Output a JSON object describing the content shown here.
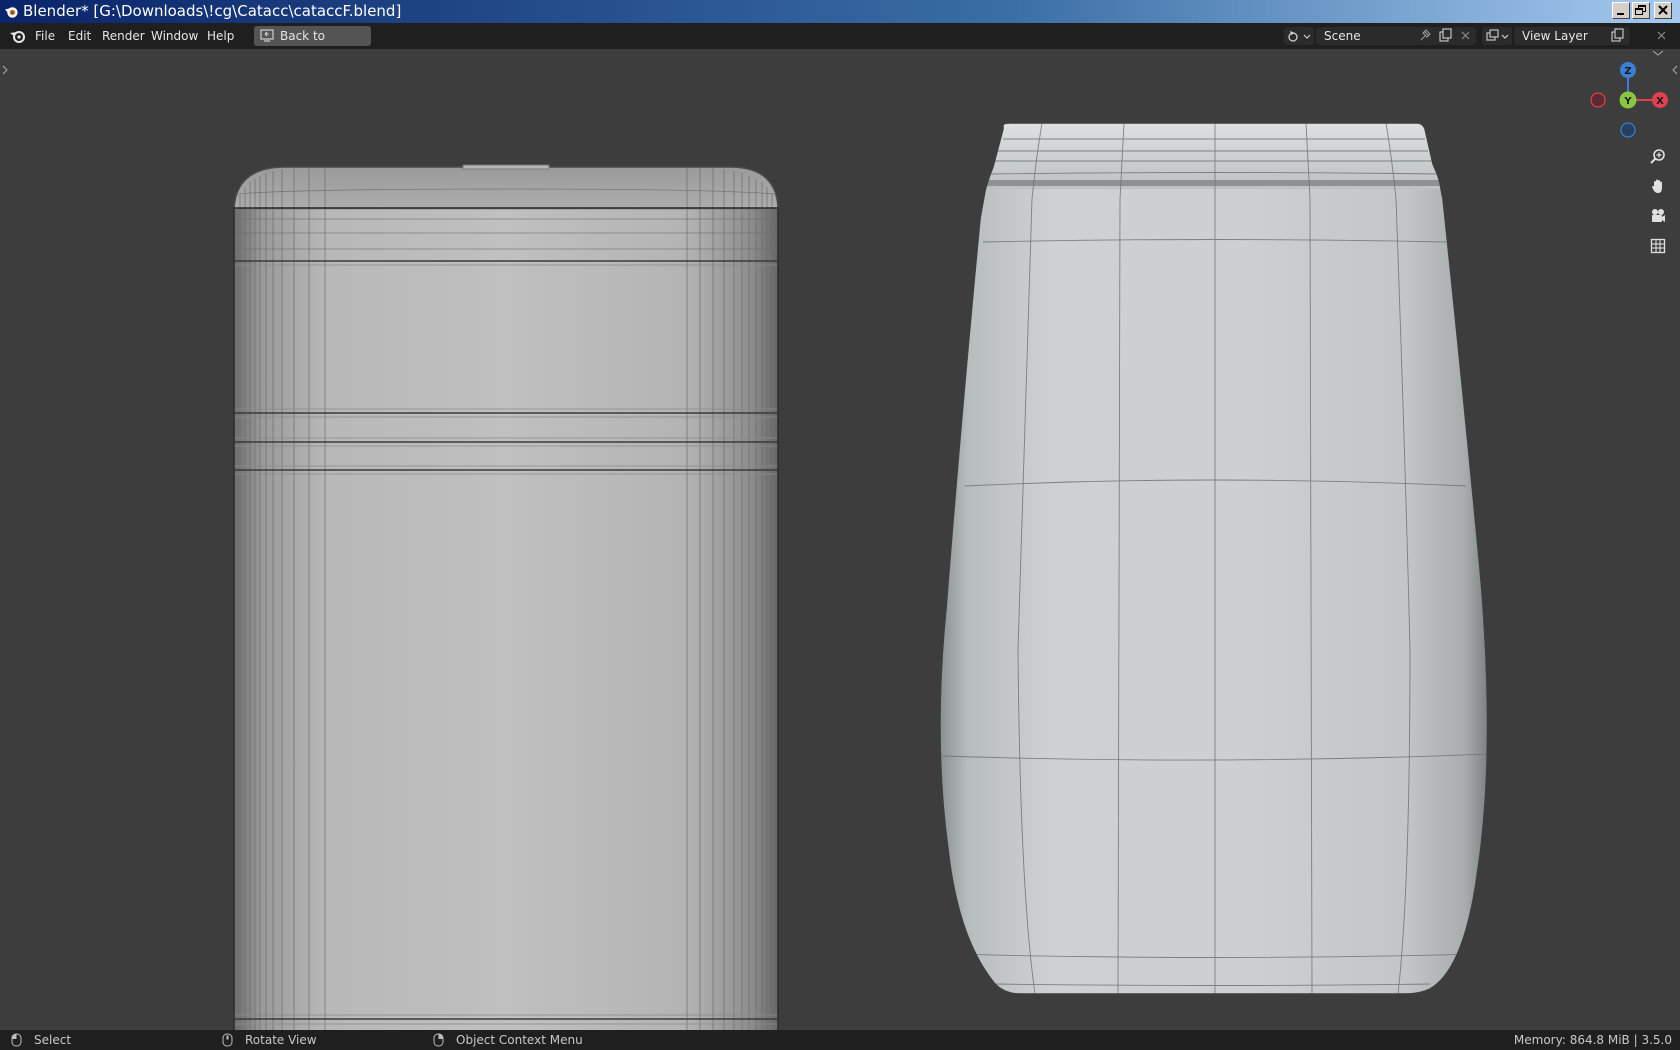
{
  "window": {
    "title": "Blender* [G:\\Downloads\\!cg\\Catacc\\cataccF.blend]"
  },
  "menu": {
    "items": [
      "File",
      "Edit",
      "Render",
      "Window",
      "Help"
    ],
    "back_button": "Back to Previous"
  },
  "header": {
    "scene": "Scene",
    "view_layer": "View Layer"
  },
  "gizmo": {
    "z": "Z",
    "y": "Y",
    "x": "X"
  },
  "status": {
    "select": "Select",
    "rotate": "Rotate View",
    "context_menu": "Object Context Menu",
    "memory": "Memory: 864.8 MiB | 3.5.0"
  },
  "colors": {
    "gizmo_x": "#e0404f",
    "gizmo_y": "#8bc63f",
    "gizmo_z": "#3a7fd5",
    "viewport_bg": "#3d3d3d"
  }
}
